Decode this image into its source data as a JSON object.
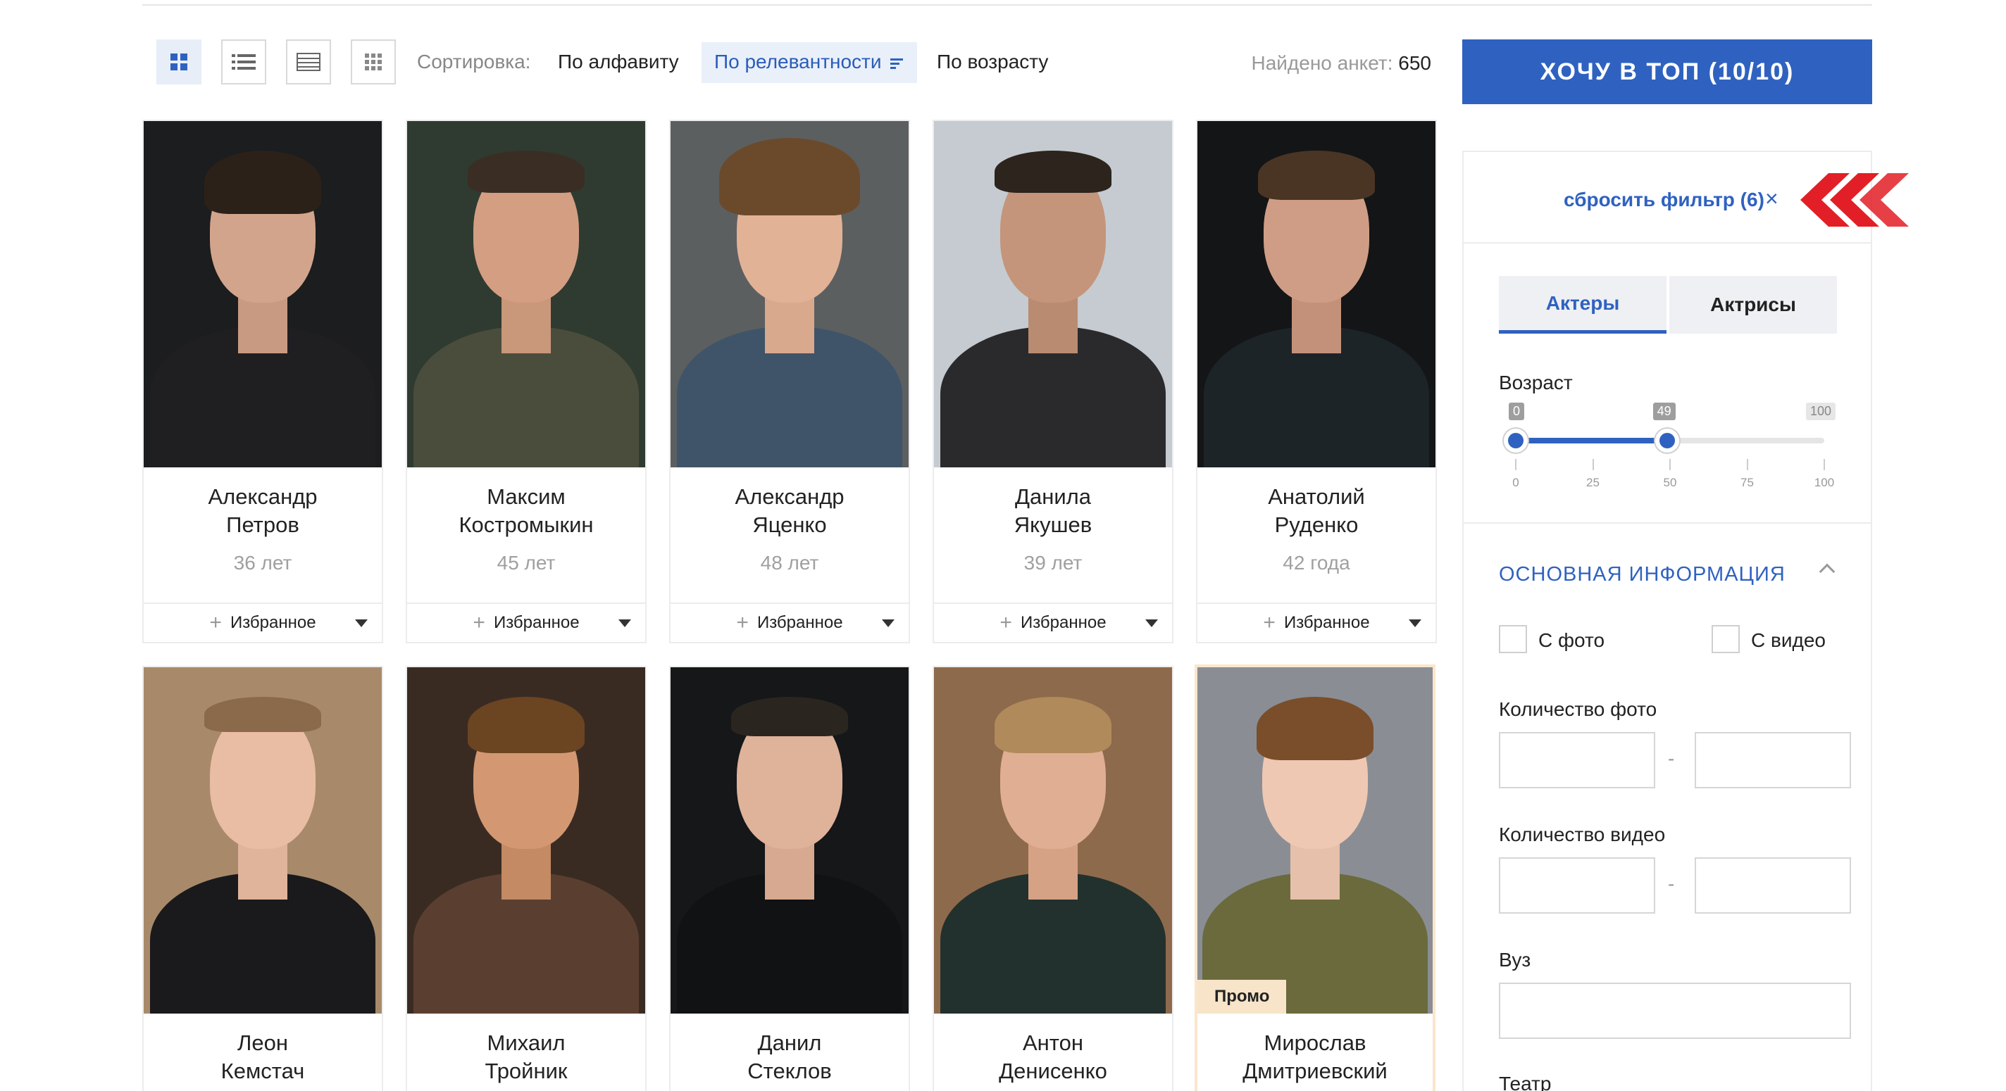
{
  "toolbar": {
    "sort_label": "Сортировка:",
    "sort_options": [
      "По алфавиту",
      "По релевантности",
      "По возрасту"
    ],
    "active_sort": "По релевантности",
    "found_label": "Найдено анкет:",
    "found_count": "650",
    "top_button": "ХОЧУ В ТОП (10/10)",
    "views": [
      "grid-icon",
      "list-icon",
      "table-icon",
      "compact-grid-icon"
    ]
  },
  "cards": [
    {
      "first": "Александр",
      "last": "Петров",
      "age": "36 лет",
      "fav": "Избранное",
      "promo": ""
    },
    {
      "first": "Максим",
      "last": "Костромыкин",
      "age": "45 лет",
      "fav": "Избранное",
      "promo": ""
    },
    {
      "first": "Александр",
      "last": "Яценко",
      "age": "48 лет",
      "fav": "Избранное",
      "promo": ""
    },
    {
      "first": "Данила",
      "last": "Якушев",
      "age": "39 лет",
      "fav": "Избранное",
      "promo": ""
    },
    {
      "first": "Анатолий",
      "last": "Руденко",
      "age": "42 года",
      "fav": "Избранное",
      "promo": ""
    },
    {
      "first": "Леон",
      "last": "Кемстач",
      "age": "",
      "fav": "",
      "promo": ""
    },
    {
      "first": "Михаил",
      "last": "Тройник",
      "age": "",
      "fav": "",
      "promo": ""
    },
    {
      "first": "Данил",
      "last": "Стеклов",
      "age": "",
      "fav": "",
      "promo": ""
    },
    {
      "first": "Антон",
      "last": "Денисенко",
      "age": "",
      "fav": "",
      "promo": ""
    },
    {
      "first": "Мирослав",
      "last": "Дмитриевский",
      "age": "",
      "fav": "",
      "promo": "Промо"
    }
  ],
  "filters": {
    "reset_label": "сбросить фильтр (6)",
    "reset_close": "×",
    "tabs": [
      "Актеры",
      "Актрисы"
    ],
    "active_tab": "Актеры",
    "age": {
      "title": "Возраст",
      "min": 0,
      "max": 100,
      "low": 0,
      "high": 49,
      "low_label": "0",
      "high_label": "49",
      "max_label": "100",
      "ticks": [
        "0",
        "25",
        "50",
        "75",
        "100"
      ]
    },
    "section_title": "ОСНОВНАЯ ИНФОРМАЦИЯ",
    "checkbox_photo": "С фото",
    "checkbox_video": "С видео",
    "photo_count_label": "Количество фото",
    "video_count_label": "Количество видео",
    "university_label": "Вуз",
    "theatre_label": "Театр",
    "range_dash": "-"
  },
  "colors": {
    "accent": "#2f62c0",
    "promo": "#f7e4c9",
    "arrows": "#e21f26"
  }
}
